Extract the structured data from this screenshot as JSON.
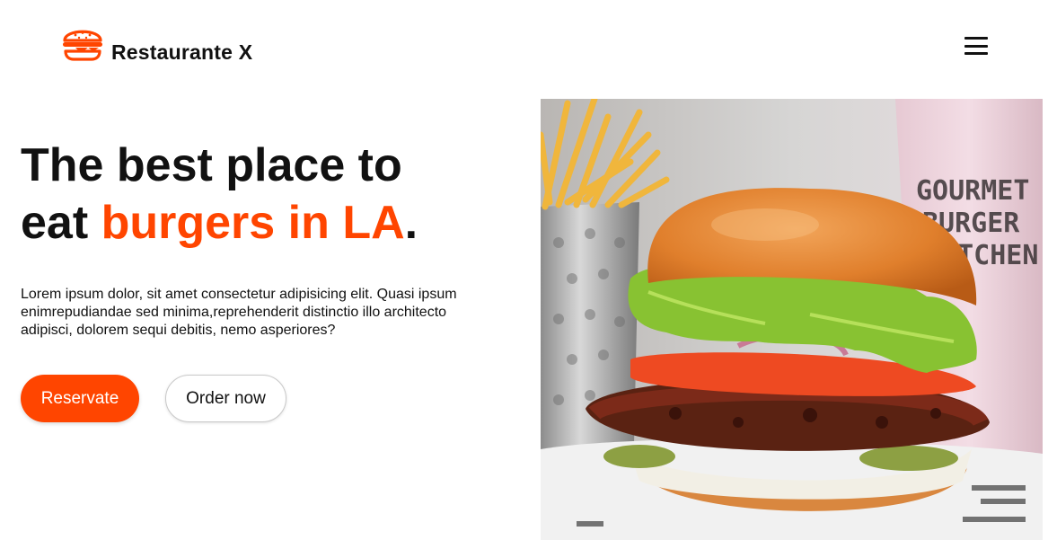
{
  "header": {
    "brand": "Restaurante X",
    "logo_icon": "burger-icon",
    "menu_icon": "hamburger-menu-icon"
  },
  "hero": {
    "title_line1": "The best place to",
    "title_pre": "eat ",
    "title_accent": "burgers in LA",
    "title_post": ".",
    "description": "Lorem ipsum dolor, sit amet consectetur adipisicing elit. Quasi ipsum enimrepudiandae sed minima,reprehenderit distinctio illo architecto adipisci, dolorem sequi debitis, nemo asperiores?",
    "primary_button": "Reservate",
    "secondary_button": "Order now",
    "image": {
      "subject": "burger-photo",
      "cup_text": [
        "GOURMET",
        "BURGER",
        "KITCHEN"
      ]
    }
  },
  "colors": {
    "accent": "#ff4500",
    "text": "#111111",
    "background": "#ffffff"
  }
}
